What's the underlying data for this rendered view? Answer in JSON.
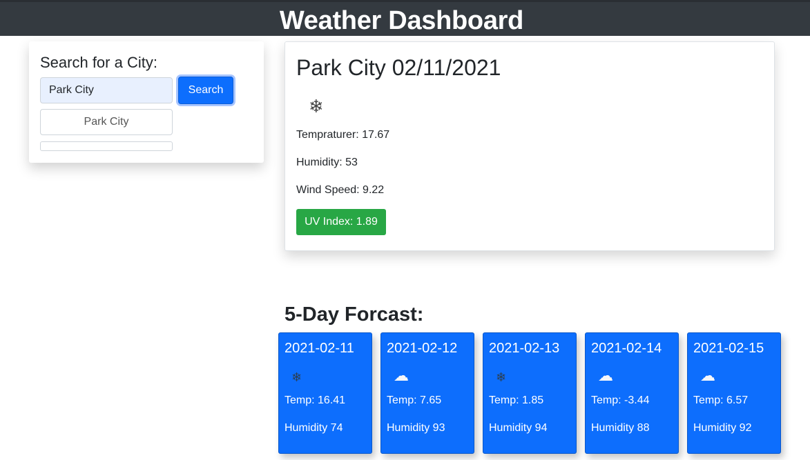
{
  "header": {
    "title": "Weather Dashboard"
  },
  "search": {
    "heading": "Search for a City:",
    "input_value": "Park City",
    "button_label": "Search",
    "history": [
      "Park City"
    ]
  },
  "current": {
    "title": "Park City 02/11/2021",
    "icon": "snow-icon",
    "temperature": "Tempraturer: 17.67",
    "humidity": "Humidity: 53",
    "wind": "Wind Speed: 9.22",
    "uv": "UV Index: 1.89",
    "uv_color": "#28a745"
  },
  "forecast": {
    "heading": "5-Day Forcast:",
    "card_color": "#0d6efd",
    "days": [
      {
        "date": "2021-02-11",
        "icon": "snow-icon",
        "temp": "Temp: 16.41",
        "humidity": "Humidity 74"
      },
      {
        "date": "2021-02-12",
        "icon": "cloud-icon",
        "temp": "Temp: 7.65",
        "humidity": "Humidity 93"
      },
      {
        "date": "2021-02-13",
        "icon": "snow-icon",
        "temp": "Temp: 1.85",
        "humidity": "Humidity 94"
      },
      {
        "date": "2021-02-14",
        "icon": "cloud-icon",
        "temp": "Temp: -3.44",
        "humidity": "Humidity 88"
      },
      {
        "date": "2021-02-15",
        "icon": "cloud-icon",
        "temp": "Temp: 6.57",
        "humidity": "Humidity 92"
      }
    ]
  }
}
